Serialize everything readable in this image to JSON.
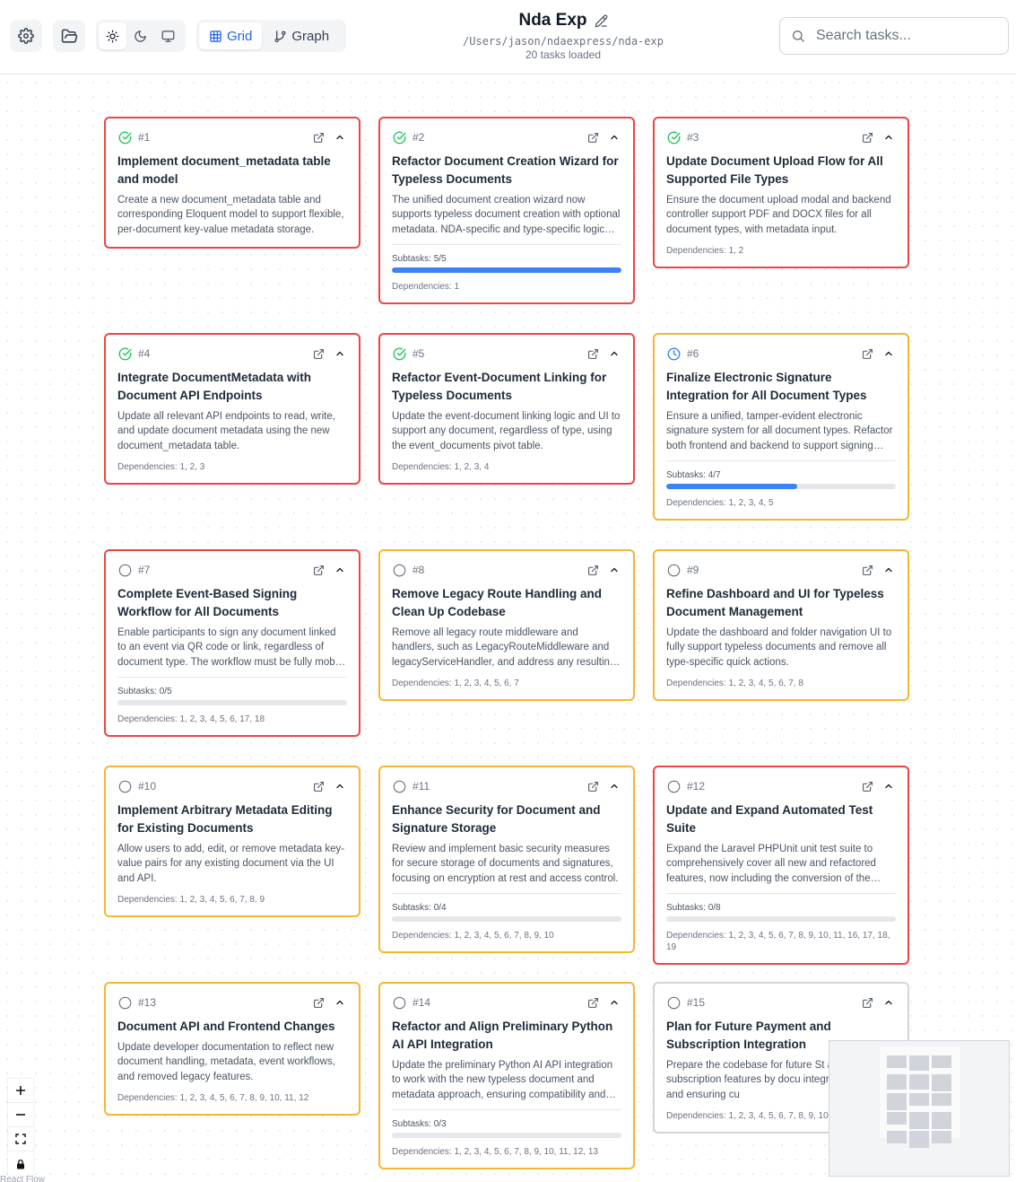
{
  "header": {
    "title": "Nda Exp",
    "path": "/Users/jason/ndaexpress/nda-exp",
    "loaded": "20 tasks loaded",
    "view_grid": "Grid",
    "view_graph": "Graph",
    "search_placeholder": "Search tasks..."
  },
  "colors": {
    "red_border": "#ef4444",
    "amber_border": "#f5b731",
    "gray_border": "#d1d5db",
    "done": "#22c55e",
    "in_progress": "#3b82f6",
    "progress_fill": "#3b82f6"
  },
  "tasks": [
    {
      "id": "#1",
      "status": "done",
      "border": "red",
      "title": "Implement document_metadata table and model",
      "description": "Create a new document_metadata table and corresponding Eloquent model to support flexible, per-document key-value metadata storage.",
      "subtasks": "",
      "progress": null,
      "deps": ""
    },
    {
      "id": "#2",
      "status": "done",
      "border": "red",
      "title": "Refactor Document Creation Wizard for Typeless Documents",
      "description": "The unified document creation wizard now supports typeless document creation with optional metadata. NDA-specific and type-specific logic has been removed.",
      "subtasks": "Subtasks: 5/5",
      "progress": 1.0,
      "deps": "Dependencies: 1"
    },
    {
      "id": "#3",
      "status": "done",
      "border": "red",
      "title": "Update Document Upload Flow for All Supported File Types",
      "description": "Ensure the document upload modal and backend controller support PDF and DOCX files for all document types, with metadata input.",
      "subtasks": "",
      "progress": null,
      "deps": "Dependencies: 1, 2"
    },
    {
      "id": "#4",
      "status": "done",
      "border": "red",
      "title": "Integrate DocumentMetadata with Document API Endpoints",
      "description": "Update all relevant API endpoints to read, write, and update document metadata using the new document_metadata table.",
      "subtasks": "",
      "progress": null,
      "deps": "Dependencies: 1, 2, 3"
    },
    {
      "id": "#5",
      "status": "done",
      "border": "red",
      "title": "Refactor Event-Document Linking for Typeless Documents",
      "description": "Update the event-document linking logic and UI to support any document, regardless of type, using the event_documents pivot table.",
      "subtasks": "",
      "progress": null,
      "deps": "Dependencies: 1, 2, 3, 4"
    },
    {
      "id": "#6",
      "status": "in-progress",
      "border": "amber",
      "title": "Finalize Electronic Signature Integration for All Document Types",
      "description": "Ensure a unified, tamper-evident electronic signature system for all document types. Refactor both frontend and backend to support signing flows.",
      "subtasks": "Subtasks: 4/7",
      "progress": 0.57,
      "deps": "Dependencies: 1, 2, 3, 4, 5"
    },
    {
      "id": "#7",
      "status": "pending",
      "border": "red",
      "title": "Complete Event-Based Signing Workflow for All Documents",
      "description": "Enable participants to sign any document linked to an event via QR code or link, regardless of document type. The workflow must be fully mobile friendly.",
      "subtasks": "Subtasks: 0/5",
      "progress": 0,
      "deps": "Dependencies: 1, 2, 3, 4, 5, 6, 17, 18"
    },
    {
      "id": "#8",
      "status": "pending",
      "border": "amber",
      "title": "Remove Legacy Route Handling and Clean Up Codebase",
      "description": "Remove all legacy route middleware and handlers, such as LegacyRouteMiddleware and legacyServiceHandler, and address any resulting issues.",
      "subtasks": "",
      "progress": null,
      "deps": "Dependencies: 1, 2, 3, 4, 5, 6, 7"
    },
    {
      "id": "#9",
      "status": "pending",
      "border": "amber",
      "title": "Refine Dashboard and UI for Typeless Document Management",
      "description": "Update the dashboard and folder navigation UI to fully support typeless documents and remove all type-specific quick actions.",
      "subtasks": "",
      "progress": null,
      "deps": "Dependencies: 1, 2, 3, 4, 5, 6, 7, 8"
    },
    {
      "id": "#10",
      "status": "pending",
      "border": "amber",
      "title": "Implement Arbitrary Metadata Editing for Existing Documents",
      "description": "Allow users to add, edit, or remove metadata key-value pairs for any existing document via the UI and API.",
      "subtasks": "",
      "progress": null,
      "deps": "Dependencies: 1, 2, 3, 4, 5, 6, 7, 8, 9"
    },
    {
      "id": "#11",
      "status": "pending",
      "border": "amber",
      "title": "Enhance Security for Document and Signature Storage",
      "description": "Review and implement basic security measures for secure storage of documents and signatures, focusing on encryption at rest and access control.",
      "subtasks": "Subtasks: 0/4",
      "progress": 0,
      "deps": "Dependencies: 1, 2, 3, 4, 5, 6, 7, 8, 9, 10"
    },
    {
      "id": "#12",
      "status": "pending",
      "border": "red",
      "title": "Update and Expand Automated Test Suite",
      "description": "Expand the Laravel PHPUnit unit test suite to comprehensively cover all new and refactored features, now including the conversion of the legacy tests.",
      "subtasks": "Subtasks: 0/8",
      "progress": 0,
      "deps": "Dependencies: 1, 2, 3, 4, 5, 6, 7, 8, 9, 10, 11, 16, 17, 18, 19"
    },
    {
      "id": "#13",
      "status": "pending",
      "border": "amber",
      "title": "Document API and Frontend Changes",
      "description": "Update developer documentation to reflect new document handling, metadata, event workflows, and removed legacy features.",
      "subtasks": "",
      "progress": null,
      "deps": "Dependencies: 1, 2, 3, 4, 5, 6, 7, 8, 9, 10, 11, 12"
    },
    {
      "id": "#14",
      "status": "pending",
      "border": "amber",
      "title": "Refactor and Align Preliminary Python AI API Integration",
      "description": "Update the preliminary Python AI API integration to work with the new typeless document and metadata approach, ensuring compatibility and stability.",
      "subtasks": "Subtasks: 0/3",
      "progress": 0,
      "deps": "Dependencies: 1, 2, 3, 4, 5, 6, 7, 8, 9, 10, 11, 12, 13"
    },
    {
      "id": "#15",
      "status": "pending",
      "border": "gray",
      "title": "Plan for Future Payment and Subscription Integration",
      "description": "Prepare the codebase for future St and subscription features by docu integration points and ensuring cu",
      "subtasks": "",
      "progress": null,
      "deps": "Dependencies: 1, 2, 3, 4, 5, 6, 7, 8, 9, 10"
    }
  ],
  "controls": {
    "zoom_in": "+",
    "zoom_out": "−",
    "attribution": "React Flow"
  }
}
